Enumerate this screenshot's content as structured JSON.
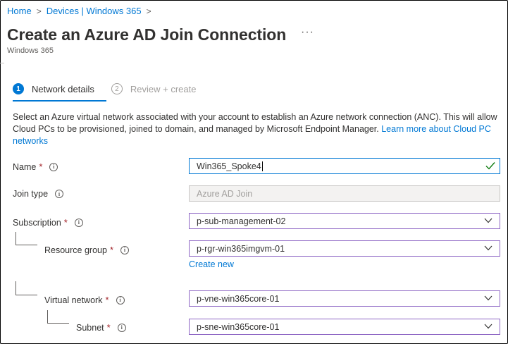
{
  "breadcrumb": {
    "items": [
      "Home",
      "Devices | Windows 365"
    ]
  },
  "header": {
    "title": "Create an Azure AD Join Connection",
    "subtitle": "Windows 365",
    "more": "···"
  },
  "steps": [
    {
      "number": "1",
      "label": "Network details",
      "state": "active"
    },
    {
      "number": "2",
      "label": "Review + create",
      "state": "inactive"
    }
  ],
  "description": {
    "text": "Select an Azure virtual network associated with your account to establish an Azure network connection (ANC). This will allow Cloud PCs to be provisioned, joined to domain, and managed by Microsoft Endpoint Manager. ",
    "link": "Learn more about Cloud PC networks"
  },
  "form": {
    "name": {
      "label": "Name",
      "value": "Win365_Spoke4",
      "valid": true
    },
    "join_type": {
      "label": "Join type",
      "value": "Azure AD Join"
    },
    "subscription": {
      "label": "Subscription",
      "value": "p-sub-management-02"
    },
    "resource_group": {
      "label": "Resource group",
      "value": "p-rgr-win365imgvm-01",
      "create_new": "Create new"
    },
    "virtual_network": {
      "label": "Virtual network",
      "value": "p-vne-win365core-01"
    },
    "subnet": {
      "label": "Subnet",
      "value": "p-sne-win365core-01"
    }
  },
  "colors": {
    "accent": "#0078d4",
    "required": "#a4262c",
    "select_border": "#8d65c4",
    "valid": "#107c10"
  },
  "icons": {
    "info": "info-icon",
    "chevron": "chevron-down-icon",
    "check": "checkmark-icon"
  }
}
